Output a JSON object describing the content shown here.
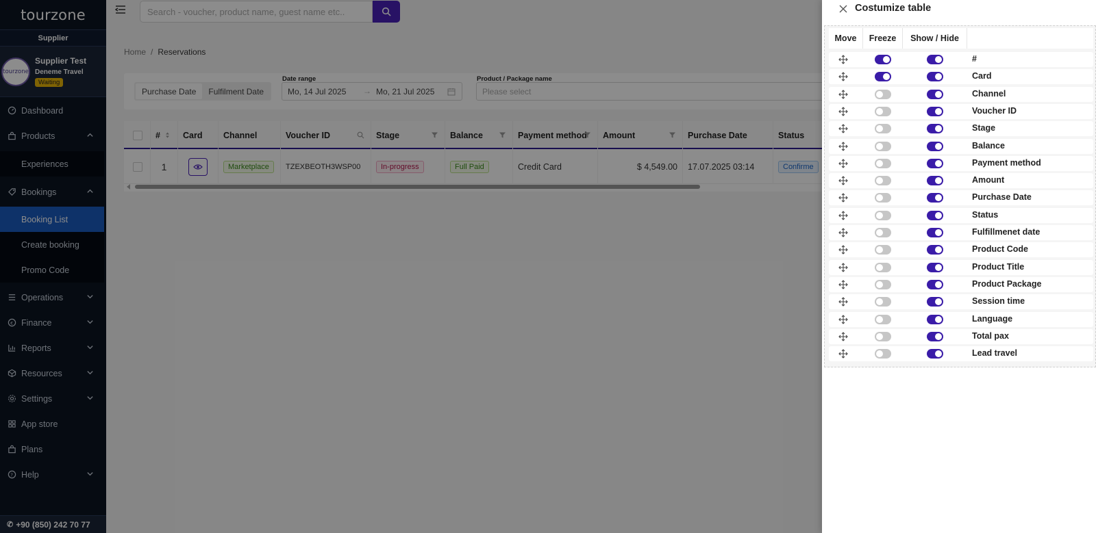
{
  "sidebar": {
    "logo": "tourzone",
    "role": "Supplier",
    "profile": {
      "avatar_text": "tourzone",
      "name": "Supplier Test",
      "company": "Deneme Travel",
      "status": "Waiting"
    },
    "items": [
      {
        "label": "Dashboard",
        "icon": "dashboard-icon"
      },
      {
        "label": "Products",
        "icon": "bag-icon"
      },
      {
        "label": "Experiences"
      },
      {
        "label": "Bookings",
        "icon": "tag-icon"
      },
      {
        "label": "Booking List"
      },
      {
        "label": "Create booking"
      },
      {
        "label": "Promo Code"
      },
      {
        "label": "Operations",
        "icon": "list-icon"
      },
      {
        "label": "Finance",
        "icon": "euro-icon"
      },
      {
        "label": "Reports",
        "icon": "chart-icon"
      },
      {
        "label": "Resources",
        "icon": "box-icon"
      },
      {
        "label": "Settings",
        "icon": "gear-icon"
      },
      {
        "label": "App store",
        "icon": "apps-icon"
      },
      {
        "label": "Plans",
        "icon": "bag-icon"
      },
      {
        "label": "Help",
        "icon": "help-icon"
      }
    ],
    "phone": "+90 (850) 242 70 77"
  },
  "topbar": {
    "search_placeholder": "Search - voucher, product name, guest name etc.."
  },
  "breadcrumb": {
    "home": "Home",
    "separator": "/",
    "current": "Reservations"
  },
  "filters": {
    "date_tabs": [
      "Purchase Date",
      "Fulfilment Date"
    ],
    "date_range_label": "Date range",
    "date_from": "Mo, 14 Jul 2025",
    "date_to": "Mo, 21 Jul 2025",
    "product_label": "Product / Package name",
    "product_placeholder": "Please select"
  },
  "table": {
    "headers": [
      "#",
      "Card",
      "Channel",
      "Voucher ID",
      "Stage",
      "Balance",
      "Payment method",
      "Amount",
      "Purchase Date",
      "Status"
    ],
    "row": {
      "num": "1",
      "channel": "Marketplace",
      "voucher": "TZEXBEOTH3WSP00",
      "stage": "In-progress",
      "balance": "Full Paid",
      "payment": "Credit Card",
      "amount": "$ 4,549.00",
      "purchase_date": "17.07.2025 03:14",
      "status": "Confirme"
    }
  },
  "drawer": {
    "title": "Costumize table",
    "headers": {
      "move": "Move",
      "freeze": "Freeze",
      "show": "Show / Hide"
    },
    "columns": [
      {
        "label": "#",
        "freeze": true,
        "show": true
      },
      {
        "label": "Card",
        "freeze": true,
        "show": true
      },
      {
        "label": "Channel",
        "freeze": false,
        "show": true
      },
      {
        "label": "Voucher ID",
        "freeze": false,
        "show": true
      },
      {
        "label": "Stage",
        "freeze": false,
        "show": true
      },
      {
        "label": "Balance",
        "freeze": false,
        "show": true
      },
      {
        "label": "Payment method",
        "freeze": false,
        "show": true
      },
      {
        "label": "Amount",
        "freeze": false,
        "show": true
      },
      {
        "label": "Purchase Date",
        "freeze": false,
        "show": true
      },
      {
        "label": "Status",
        "freeze": false,
        "show": true
      },
      {
        "label": "Fulfillmenet date",
        "freeze": false,
        "show": true
      },
      {
        "label": "Product Code",
        "freeze": false,
        "show": true
      },
      {
        "label": "Product Title",
        "freeze": false,
        "show": true
      },
      {
        "label": "Product Package",
        "freeze": false,
        "show": true
      },
      {
        "label": "Session time",
        "freeze": false,
        "show": true
      },
      {
        "label": "Language",
        "freeze": false,
        "show": true
      },
      {
        "label": "Total pax",
        "freeze": false,
        "show": true
      },
      {
        "label": "Lead travel",
        "freeze": false,
        "show": true
      }
    ]
  },
  "colors": {
    "accent": "#4a22b8",
    "toggle_on": "#3a1ca8",
    "sidebar_bg": "#0b1422",
    "active_nav": "#1b5bbf"
  }
}
